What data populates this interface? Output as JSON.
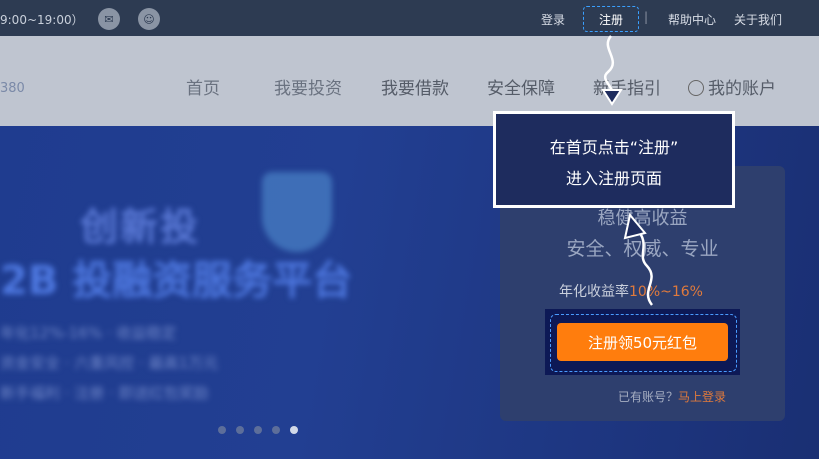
{
  "topbar": {
    "hours": "9:00~19:00）",
    "login": "登录",
    "register": "注册",
    "separator": "|",
    "help": "帮助中心",
    "about": "关于我们"
  },
  "nav": {
    "logo_fragment": "380",
    "items": [
      "首页",
      "我要投资",
      "我要借款",
      "安全保障",
      "新手指引",
      "我的账户"
    ]
  },
  "callout": {
    "line1": "在首页点击“注册”",
    "line2": "进入注册页面"
  },
  "hero": {
    "title1": "创新投",
    "title2": "2B 投融资服务平台",
    "lines": [
      "年化12%-16% · 收益稳定",
      "资金安全 · 六重风控 · 最高1万元",
      "新手福利 · 注册 · 即送红包奖励"
    ]
  },
  "card": {
    "line1": "稳健高收益",
    "line2": "安全、权威、专业",
    "rate_label": "年化收益率",
    "rate_value": "10%~16%",
    "cta": "注册领50元红包",
    "have_account": "已有账号？",
    "login_now": "马上登录"
  },
  "colors": {
    "accent_orange": "#ff7d0d",
    "dash_blue": "#4a9cff",
    "hero_blue": "#1f3c8f"
  }
}
